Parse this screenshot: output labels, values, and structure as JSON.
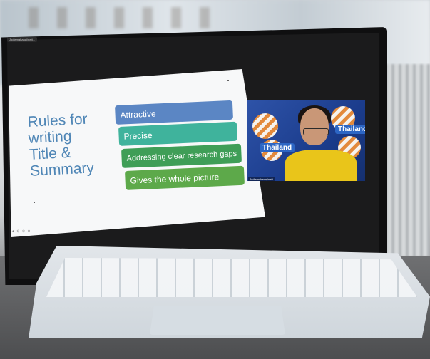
{
  "meeting": {
    "tag": "Jodiemahanaj/nett..."
  },
  "slide": {
    "title_lines": [
      "Rules for",
      "writing",
      "Title &",
      "Summary"
    ],
    "rules": [
      "Attractive",
      "Precise",
      "Addressing clear research gaps",
      "Gives the whole picture"
    ]
  },
  "video": {
    "badge_text": "Thailand",
    "participant_label": "Jodiemahanaj/nett"
  },
  "colors": {
    "rule_1": "#5b86c4",
    "rule_2": "#3fb39c",
    "rule_3": "#3f9e57",
    "rule_4": "#5da94a",
    "title": "#4f86b6"
  }
}
